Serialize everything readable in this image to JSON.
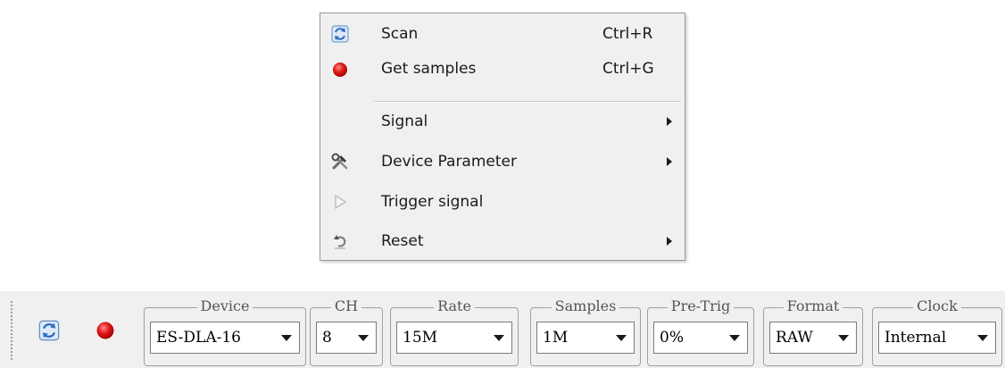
{
  "context_menu": {
    "items": [
      {
        "label": "Scan",
        "shortcut": "Ctrl+R",
        "icon": "refresh-icon"
      },
      {
        "label": "Get samples",
        "shortcut": "Ctrl+G",
        "icon": "record-dot-icon"
      },
      {
        "label": "Signal",
        "shortcut": "",
        "icon": "",
        "submenu": true
      },
      {
        "label": "Device Parameter",
        "shortcut": "",
        "icon": "tools-icon",
        "submenu": true
      },
      {
        "label": "Trigger signal",
        "shortcut": "",
        "icon": "play-triangle-icon"
      },
      {
        "label": "Reset",
        "shortcut": "",
        "icon": "reset-arrow-icon",
        "submenu": true
      }
    ]
  },
  "toolbar": {
    "buttons": [
      {
        "name": "scan",
        "icon": "refresh-icon"
      },
      {
        "name": "get-samples",
        "icon": "record-dot-icon"
      }
    ],
    "groups": [
      {
        "legend": "Device",
        "value": "ES-DLA-16"
      },
      {
        "legend": "CH",
        "value": "8"
      },
      {
        "legend": "Rate",
        "value": "15M"
      },
      {
        "legend": "Samples",
        "value": "1M"
      },
      {
        "legend": "Pre-Trig",
        "value": "0%"
      },
      {
        "legend": "Format",
        "value": "RAW"
      },
      {
        "legend": "Clock",
        "value": "Internal"
      }
    ]
  },
  "colors": {
    "record_red": "#e21b1b",
    "refresh_blue": "#2b6fc4",
    "menu_background": "#f0f0f0"
  }
}
